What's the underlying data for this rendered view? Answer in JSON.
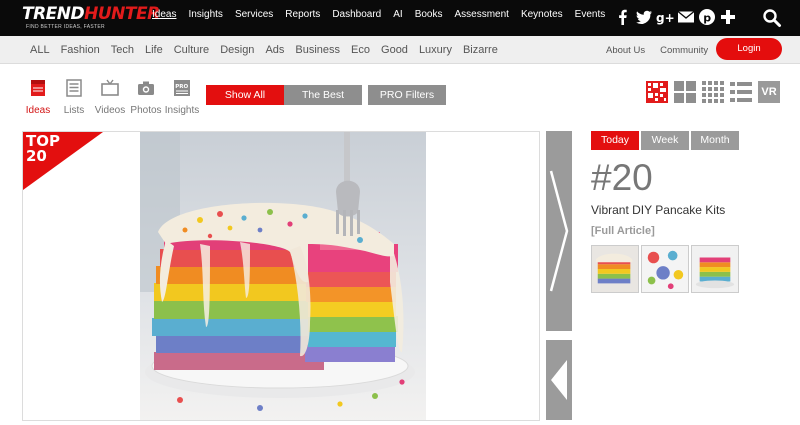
{
  "logo": {
    "name_trend": "TREND",
    "name_hunter": "HUNTER",
    "tagline": "FIND BETTER IDEAS, FASTER"
  },
  "topnav": [
    "Ideas",
    "Insights",
    "Services",
    "Reports",
    "Dashboard",
    "AI",
    "Books",
    "Assessment",
    "Keynotes",
    "Events"
  ],
  "social_icons": [
    "facebook-icon",
    "twitter-icon",
    "google-plus-icon",
    "mail-icon",
    "pinterest-icon",
    "plus-icon"
  ],
  "categories": [
    "ALL",
    "Fashion",
    "Tech",
    "Life",
    "Culture",
    "Design",
    "Ads",
    "Business",
    "Eco",
    "Good",
    "Luxury",
    "Bizarre"
  ],
  "account": {
    "about": "About Us",
    "community": "Community",
    "login": "Login"
  },
  "content_types": [
    "Ideas",
    "Lists",
    "Videos",
    "Photos",
    "Insights"
  ],
  "filters": {
    "show_all": "Show All",
    "the_best": "The Best",
    "pro_filters": "PRO Filters"
  },
  "view_modes": {
    "vr": "VR"
  },
  "ribbon": {
    "line1": "TOP",
    "line2": "20"
  },
  "period_tabs": [
    "Today",
    "Week",
    "Month"
  ],
  "article": {
    "rank": "#20",
    "title": "Vibrant DIY Pancake Kits",
    "full_article": "[Full Article]"
  },
  "colors": {
    "brand_red": "#e30f0f",
    "topbar": "#0a0a0a",
    "grey_button": "#8e8e8e"
  }
}
